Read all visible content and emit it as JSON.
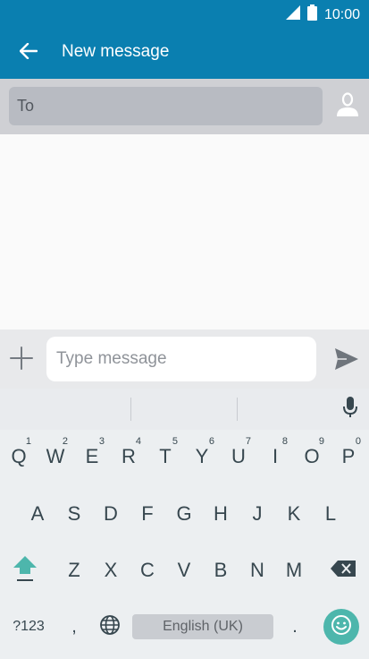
{
  "status_bar": {
    "time": "10:00"
  },
  "app_bar": {
    "title": "New message"
  },
  "recipient": {
    "label": "To"
  },
  "compose": {
    "placeholder": "Type message"
  },
  "keyboard": {
    "row1": [
      {
        "key": "Q",
        "hint": "1"
      },
      {
        "key": "W",
        "hint": "2"
      },
      {
        "key": "E",
        "hint": "3"
      },
      {
        "key": "R",
        "hint": "4"
      },
      {
        "key": "T",
        "hint": "5"
      },
      {
        "key": "Y",
        "hint": "6"
      },
      {
        "key": "U",
        "hint": "7"
      },
      {
        "key": "I",
        "hint": "8"
      },
      {
        "key": "O",
        "hint": "9"
      },
      {
        "key": "P",
        "hint": "0"
      }
    ],
    "row2": [
      "A",
      "S",
      "D",
      "F",
      "G",
      "H",
      "J",
      "K",
      "L"
    ],
    "row3": [
      "Z",
      "X",
      "C",
      "V",
      "B",
      "N",
      "M"
    ],
    "symbols_label": "?123",
    "comma_label": ",",
    "period_label": ".",
    "space_label": "English (UK)"
  },
  "colors": {
    "primary": "#0a7fb0",
    "accent": "#4db6ac"
  },
  "icons": [
    "signal-icon",
    "battery-icon",
    "back-arrow-icon",
    "contact-icon",
    "plus-icon",
    "send-icon",
    "mic-icon",
    "shift-icon",
    "backspace-icon",
    "globe-icon",
    "emoji-icon"
  ]
}
